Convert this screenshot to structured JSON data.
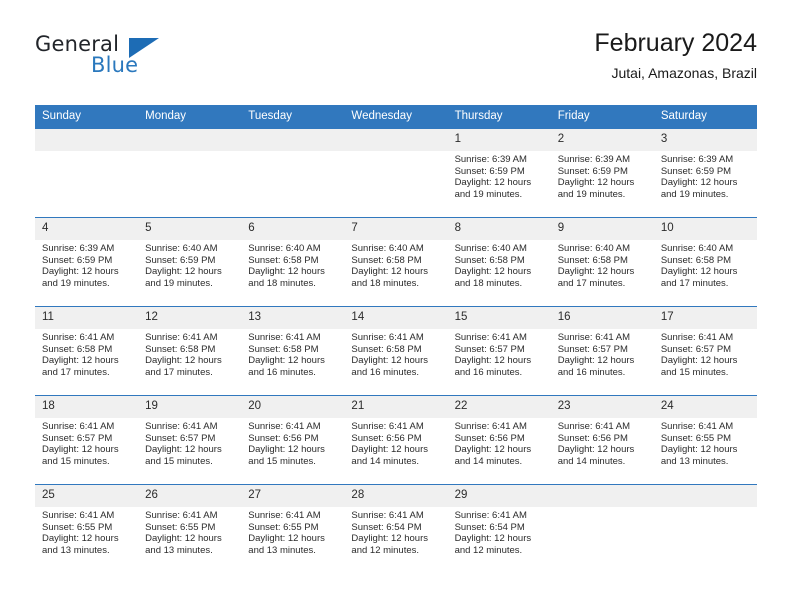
{
  "logo": {
    "word_one": "General",
    "word_two": "Blue",
    "triangle_color": "#1d6cb5",
    "blue_text_color": "#2a78bd"
  },
  "header": {
    "title": "February 2024",
    "subtitle": "Jutai, Amazonas, Brazil"
  },
  "theme": {
    "header_bg": "#3178be",
    "daynum_bg": "#f0f0f0",
    "row_divider": "#3178be",
    "text": "#2b2b2b"
  },
  "calendar": {
    "weekday_headers": [
      "Sunday",
      "Monday",
      "Tuesday",
      "Wednesday",
      "Thursday",
      "Friday",
      "Saturday"
    ],
    "labels": {
      "sunrise_prefix": "Sunrise: ",
      "sunset_prefix": "Sunset: ",
      "daylight_prefix": "Daylight: "
    },
    "weeks": [
      [
        {
          "day": "",
          "sunrise": "",
          "sunset": "",
          "daylight": "",
          "empty": true
        },
        {
          "day": "",
          "sunrise": "",
          "sunset": "",
          "daylight": "",
          "empty": true
        },
        {
          "day": "",
          "sunrise": "",
          "sunset": "",
          "daylight": "",
          "empty": true
        },
        {
          "day": "",
          "sunrise": "",
          "sunset": "",
          "daylight": "",
          "empty": true
        },
        {
          "day": "1",
          "sunrise": "Sunrise: 6:39 AM",
          "sunset": "Sunset: 6:59 PM",
          "daylight": "Daylight: 12 hours and 19 minutes.",
          "empty": false
        },
        {
          "day": "2",
          "sunrise": "Sunrise: 6:39 AM",
          "sunset": "Sunset: 6:59 PM",
          "daylight": "Daylight: 12 hours and 19 minutes.",
          "empty": false
        },
        {
          "day": "3",
          "sunrise": "Sunrise: 6:39 AM",
          "sunset": "Sunset: 6:59 PM",
          "daylight": "Daylight: 12 hours and 19 minutes.",
          "empty": false
        }
      ],
      [
        {
          "day": "4",
          "sunrise": "Sunrise: 6:39 AM",
          "sunset": "Sunset: 6:59 PM",
          "daylight": "Daylight: 12 hours and 19 minutes.",
          "empty": false
        },
        {
          "day": "5",
          "sunrise": "Sunrise: 6:40 AM",
          "sunset": "Sunset: 6:59 PM",
          "daylight": "Daylight: 12 hours and 19 minutes.",
          "empty": false
        },
        {
          "day": "6",
          "sunrise": "Sunrise: 6:40 AM",
          "sunset": "Sunset: 6:58 PM",
          "daylight": "Daylight: 12 hours and 18 minutes.",
          "empty": false
        },
        {
          "day": "7",
          "sunrise": "Sunrise: 6:40 AM",
          "sunset": "Sunset: 6:58 PM",
          "daylight": "Daylight: 12 hours and 18 minutes.",
          "empty": false
        },
        {
          "day": "8",
          "sunrise": "Sunrise: 6:40 AM",
          "sunset": "Sunset: 6:58 PM",
          "daylight": "Daylight: 12 hours and 18 minutes.",
          "empty": false
        },
        {
          "day": "9",
          "sunrise": "Sunrise: 6:40 AM",
          "sunset": "Sunset: 6:58 PM",
          "daylight": "Daylight: 12 hours and 17 minutes.",
          "empty": false
        },
        {
          "day": "10",
          "sunrise": "Sunrise: 6:40 AM",
          "sunset": "Sunset: 6:58 PM",
          "daylight": "Daylight: 12 hours and 17 minutes.",
          "empty": false
        }
      ],
      [
        {
          "day": "11",
          "sunrise": "Sunrise: 6:41 AM",
          "sunset": "Sunset: 6:58 PM",
          "daylight": "Daylight: 12 hours and 17 minutes.",
          "empty": false
        },
        {
          "day": "12",
          "sunrise": "Sunrise: 6:41 AM",
          "sunset": "Sunset: 6:58 PM",
          "daylight": "Daylight: 12 hours and 17 minutes.",
          "empty": false
        },
        {
          "day": "13",
          "sunrise": "Sunrise: 6:41 AM",
          "sunset": "Sunset: 6:58 PM",
          "daylight": "Daylight: 12 hours and 16 minutes.",
          "empty": false
        },
        {
          "day": "14",
          "sunrise": "Sunrise: 6:41 AM",
          "sunset": "Sunset: 6:58 PM",
          "daylight": "Daylight: 12 hours and 16 minutes.",
          "empty": false
        },
        {
          "day": "15",
          "sunrise": "Sunrise: 6:41 AM",
          "sunset": "Sunset: 6:57 PM",
          "daylight": "Daylight: 12 hours and 16 minutes.",
          "empty": false
        },
        {
          "day": "16",
          "sunrise": "Sunrise: 6:41 AM",
          "sunset": "Sunset: 6:57 PM",
          "daylight": "Daylight: 12 hours and 16 minutes.",
          "empty": false
        },
        {
          "day": "17",
          "sunrise": "Sunrise: 6:41 AM",
          "sunset": "Sunset: 6:57 PM",
          "daylight": "Daylight: 12 hours and 15 minutes.",
          "empty": false
        }
      ],
      [
        {
          "day": "18",
          "sunrise": "Sunrise: 6:41 AM",
          "sunset": "Sunset: 6:57 PM",
          "daylight": "Daylight: 12 hours and 15 minutes.",
          "empty": false
        },
        {
          "day": "19",
          "sunrise": "Sunrise: 6:41 AM",
          "sunset": "Sunset: 6:57 PM",
          "daylight": "Daylight: 12 hours and 15 minutes.",
          "empty": false
        },
        {
          "day": "20",
          "sunrise": "Sunrise: 6:41 AM",
          "sunset": "Sunset: 6:56 PM",
          "daylight": "Daylight: 12 hours and 15 minutes.",
          "empty": false
        },
        {
          "day": "21",
          "sunrise": "Sunrise: 6:41 AM",
          "sunset": "Sunset: 6:56 PM",
          "daylight": "Daylight: 12 hours and 14 minutes.",
          "empty": false
        },
        {
          "day": "22",
          "sunrise": "Sunrise: 6:41 AM",
          "sunset": "Sunset: 6:56 PM",
          "daylight": "Daylight: 12 hours and 14 minutes.",
          "empty": false
        },
        {
          "day": "23",
          "sunrise": "Sunrise: 6:41 AM",
          "sunset": "Sunset: 6:56 PM",
          "daylight": "Daylight: 12 hours and 14 minutes.",
          "empty": false
        },
        {
          "day": "24",
          "sunrise": "Sunrise: 6:41 AM",
          "sunset": "Sunset: 6:55 PM",
          "daylight": "Daylight: 12 hours and 13 minutes.",
          "empty": false
        }
      ],
      [
        {
          "day": "25",
          "sunrise": "Sunrise: 6:41 AM",
          "sunset": "Sunset: 6:55 PM",
          "daylight": "Daylight: 12 hours and 13 minutes.",
          "empty": false
        },
        {
          "day": "26",
          "sunrise": "Sunrise: 6:41 AM",
          "sunset": "Sunset: 6:55 PM",
          "daylight": "Daylight: 12 hours and 13 minutes.",
          "empty": false
        },
        {
          "day": "27",
          "sunrise": "Sunrise: 6:41 AM",
          "sunset": "Sunset: 6:55 PM",
          "daylight": "Daylight: 12 hours and 13 minutes.",
          "empty": false
        },
        {
          "day": "28",
          "sunrise": "Sunrise: 6:41 AM",
          "sunset": "Sunset: 6:54 PM",
          "daylight": "Daylight: 12 hours and 12 minutes.",
          "empty": false
        },
        {
          "day": "29",
          "sunrise": "Sunrise: 6:41 AM",
          "sunset": "Sunset: 6:54 PM",
          "daylight": "Daylight: 12 hours and 12 minutes.",
          "empty": false
        },
        {
          "day": "",
          "sunrise": "",
          "sunset": "",
          "daylight": "",
          "empty": true
        },
        {
          "day": "",
          "sunrise": "",
          "sunset": "",
          "daylight": "",
          "empty": true
        }
      ]
    ]
  }
}
